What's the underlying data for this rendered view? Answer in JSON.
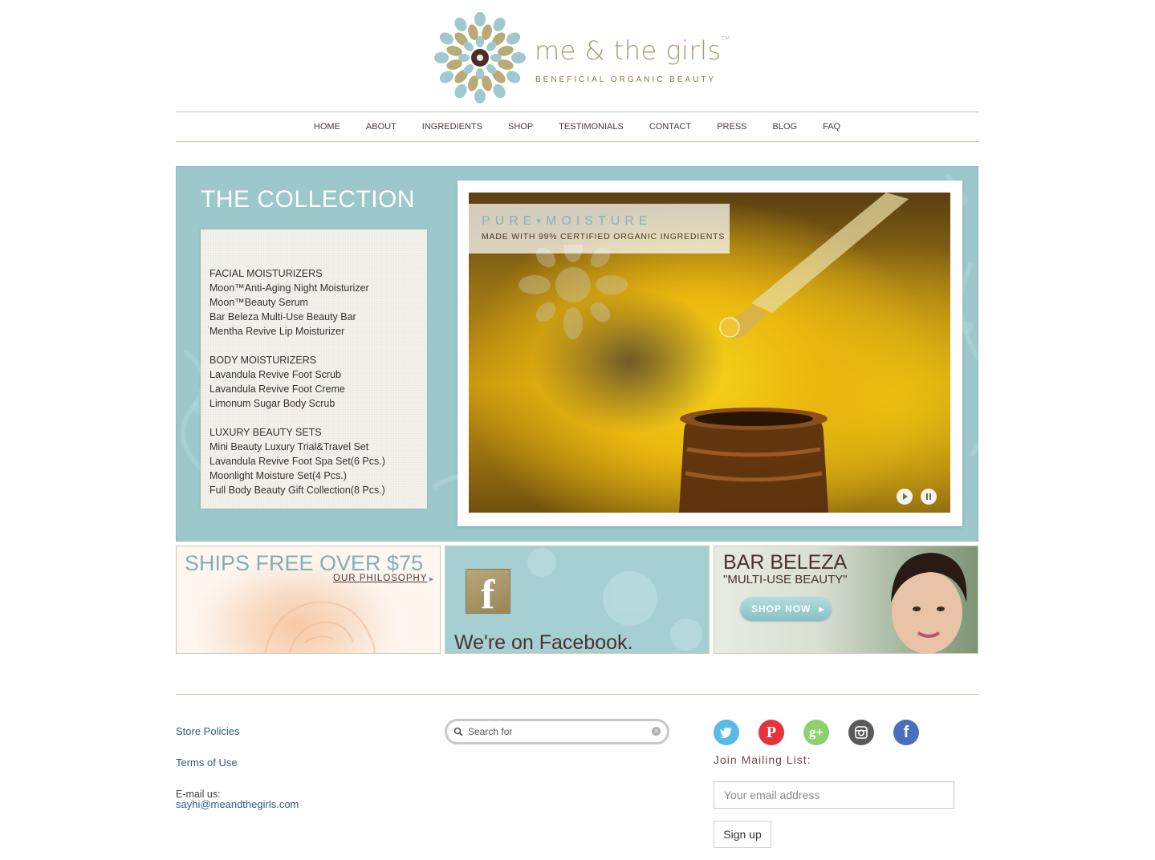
{
  "logo": {
    "name": "me & the girls",
    "tm": "TM",
    "tagline": "BENEFICIAL ORGANIC BEAUTY"
  },
  "nav": {
    "items": [
      "HOME",
      "ABOUT",
      "INGREDIENTS",
      "SHOP",
      "TESTIMONIALS",
      "CONTACT",
      "PRESS",
      "BLOG",
      "FAQ"
    ]
  },
  "hero": {
    "title": "THE COLLECTION",
    "groups": [
      {
        "heading": "FACIAL MOISTURIZERS",
        "items": [
          "Moon™Anti-Aging Night Moisturizer",
          "Moon™Beauty Serum",
          "Bar Beleza Multi-Use Beauty Bar",
          "Mentha Revive Lip Moisturizer"
        ]
      },
      {
        "heading": "BODY MOISTURIZERS",
        "items": [
          "Lavandula Revive Foot Scrub",
          "Lavandula Revive Foot Creme",
          "Limonum Sugar Body Scrub"
        ]
      },
      {
        "heading": "LUXURY BEAUTY SETS",
        "items": [
          "Mini Beauty Luxury Trial&Travel Set",
          "Lavandula Revive Foot Spa Set(6 Pcs.)",
          "Moonlight Moisture Set(4 Pcs.)",
          "Full Body Beauty Gift Collection(8 Pcs.)"
        ]
      }
    ],
    "slide": {
      "kicker": "PURE•MOISTURE",
      "subtitle": "MADE WITH 99% CERTIFIED ORGANIC INGREDIENTS"
    }
  },
  "tiles": {
    "ships": {
      "headline": "SHIPS FREE OVER $75",
      "link": "OUR PHILOSOPHY"
    },
    "facebook": {
      "headline": "We're on Facebook.",
      "icon_letter": "f"
    },
    "bar": {
      "headline": "BAR BELEZA",
      "subhead": "\"MULTI-USE BEAUTY\"",
      "button": "SHOP NOW"
    }
  },
  "footer": {
    "store_policies": "Store Policies",
    "terms": "Terms of Use",
    "email_label": "E-mail us:",
    "email": "sayhi@meandthegirls.com",
    "search_placeholder": "Search for",
    "join": "Join Mailing List:",
    "email_placeholder": "Your email address",
    "signup": "Sign up",
    "social": [
      "twitter-icon",
      "pinterest-icon",
      "google-plus-icon",
      "instagram-icon",
      "facebook-icon"
    ]
  },
  "colors": {
    "accent_teal": "#9cc7cb",
    "gold": "#a89a6a",
    "link_blue": "#2f5c8a"
  }
}
